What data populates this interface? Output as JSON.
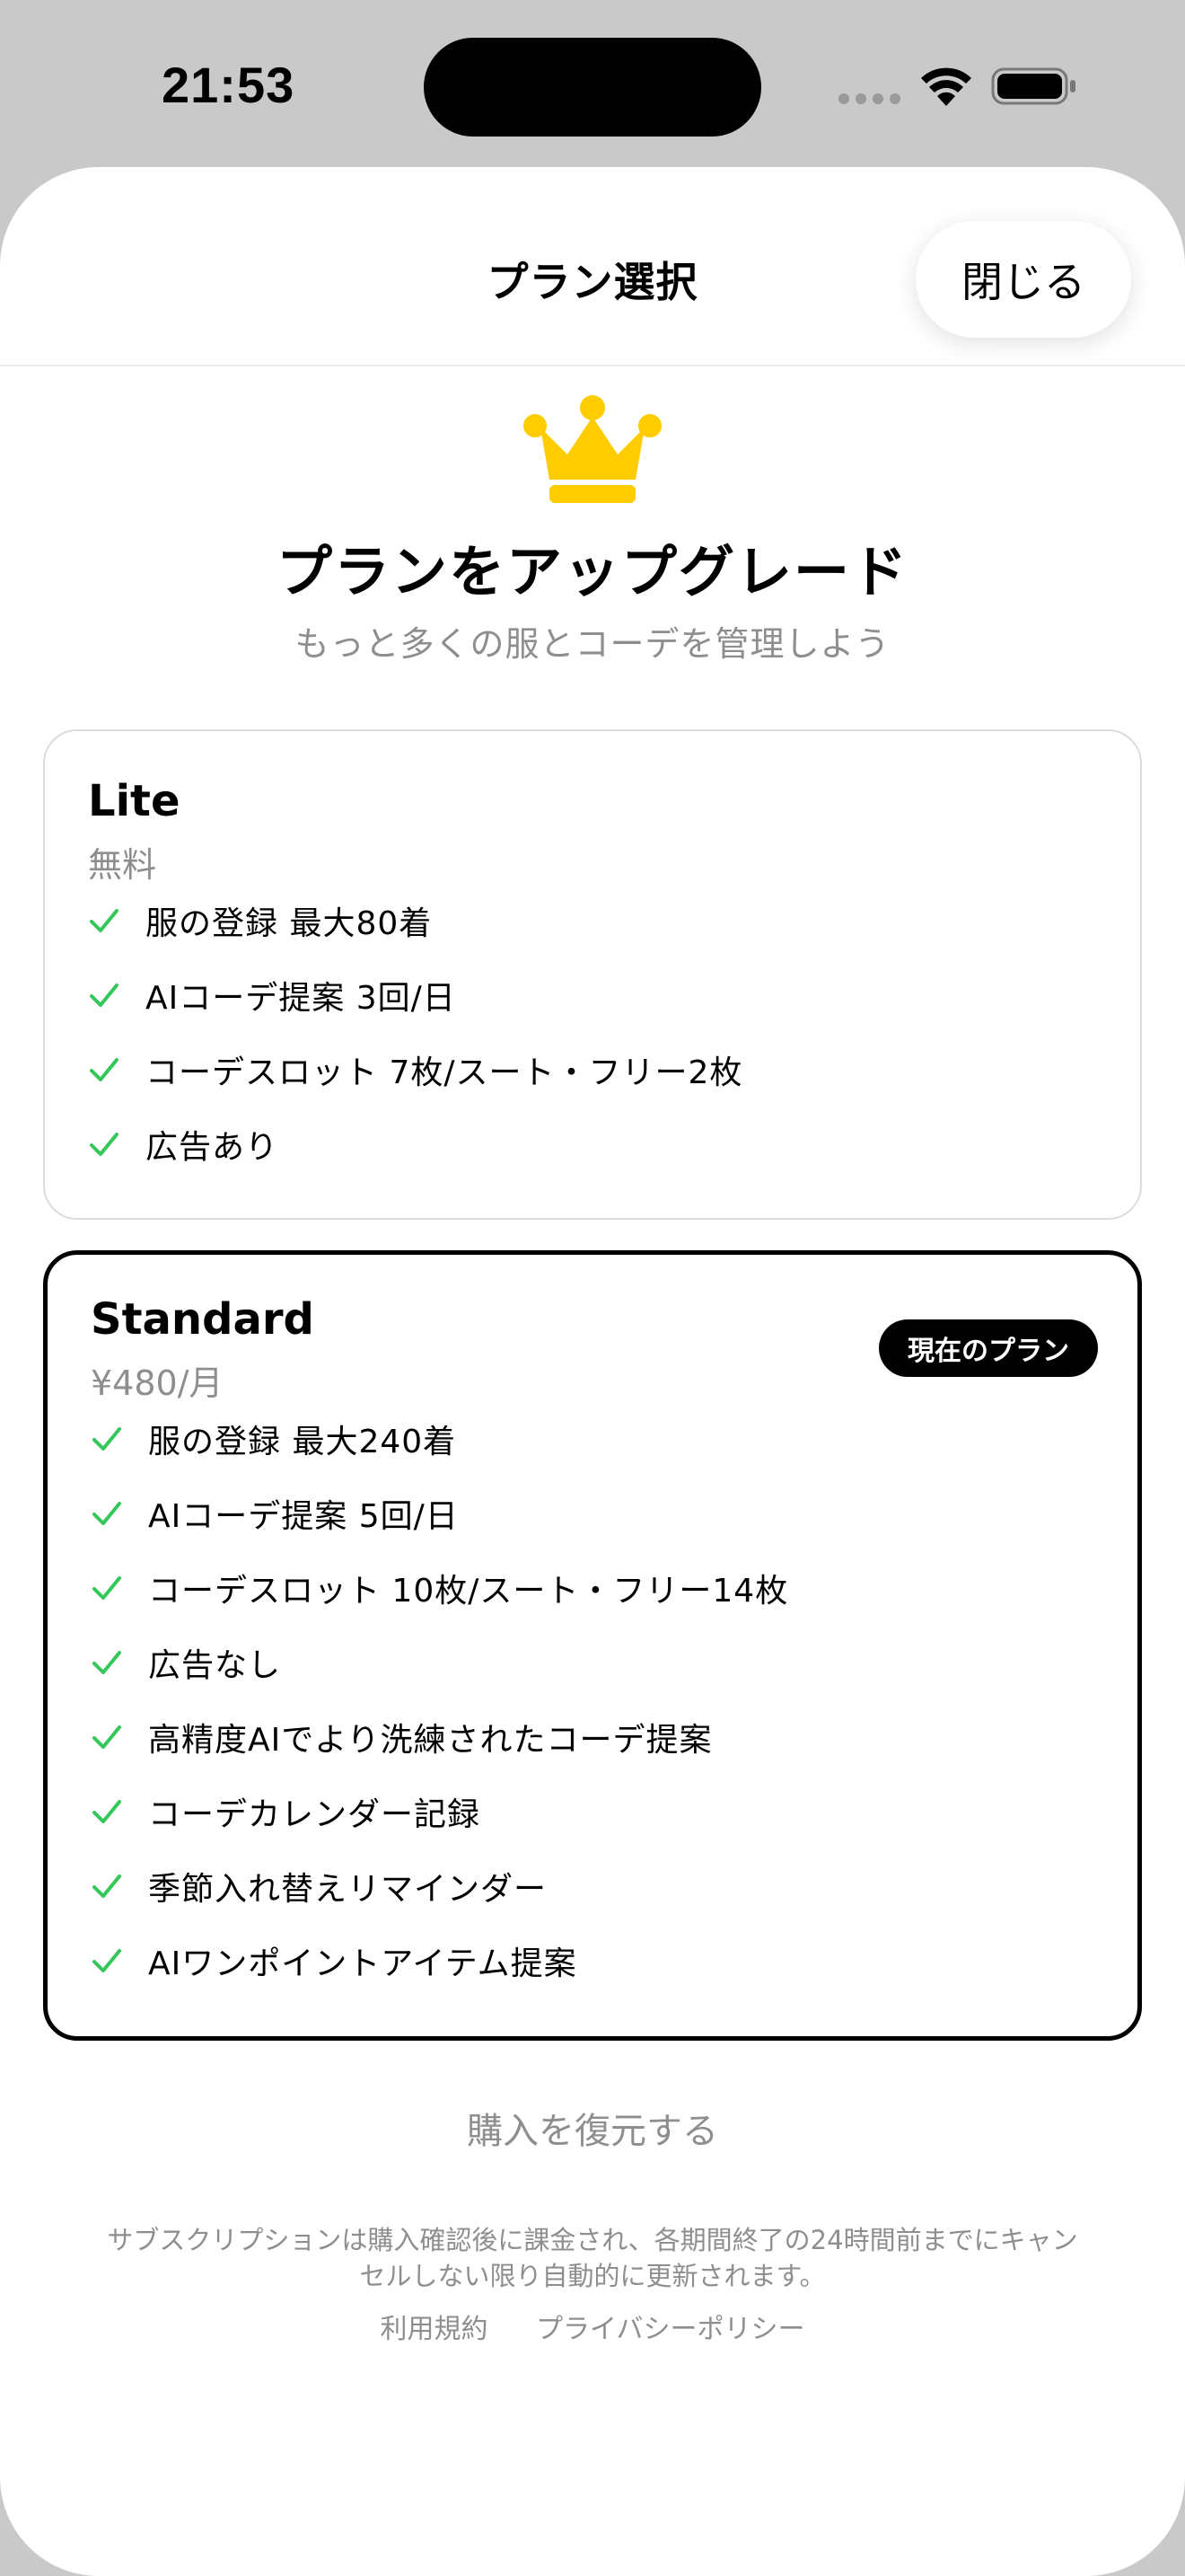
{
  "status_bar": {
    "time": "21:53"
  },
  "nav": {
    "title": "プラン選択",
    "close_label": "閉じる"
  },
  "header": {
    "icon": "crown-icon",
    "title": "プランをアップグレード",
    "subtitle": "もっと多くの服とコーデを管理しよう"
  },
  "plans": [
    {
      "name": "Lite",
      "price": "無料",
      "features": [
        "服の登録 最大80着",
        "AIコーデ提案 3回/日",
        "コーデスロット 7枚/スート・フリー2枚",
        "広告あり"
      ]
    },
    {
      "name": "Standard",
      "price": "¥480/月",
      "badge": "現在のプラン",
      "features": [
        "服の登録 最大240着",
        "AIコーデ提案 5回/日",
        "コーデスロット 10枚/スート・フリー14枚",
        "広告なし",
        "高精度AIでより洗練されたコーデ提案",
        "コーデカレンダー記録",
        "季節入れ替えリマインダー",
        "AIワンポイントアイテム提案"
      ]
    }
  ],
  "footer": {
    "restore_label": "購入を復元する",
    "legal_line1": "サブスクリプションは購入確認後に課金され、各期間終了の24時間前までにキャン",
    "legal_line2": "セルしない限り自動的に更新されます。",
    "terms_label": "利用規約",
    "privacy_label": "プライバシーポリシー"
  },
  "colors": {
    "accent_check": "#34c759",
    "crown": "#ffcc00",
    "badge_bg": "#000000"
  }
}
